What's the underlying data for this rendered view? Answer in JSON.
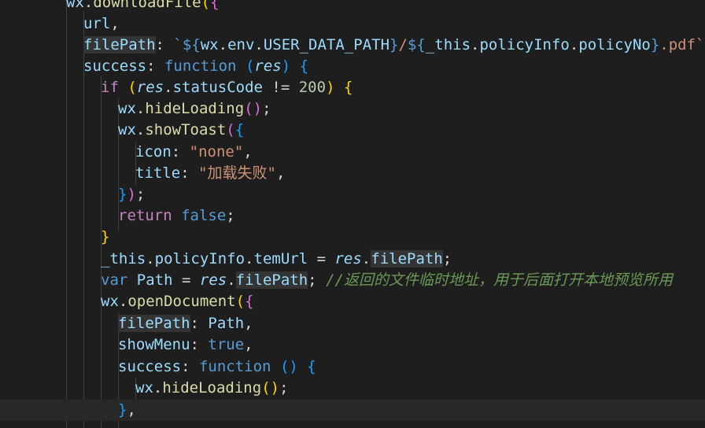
{
  "editor": {
    "lines": [
      [
        [
          "wx",
          "var"
        ],
        [
          ".",
          "p"
        ],
        [
          "downloadFile",
          "fn"
        ],
        [
          "(",
          "b1"
        ],
        [
          "{",
          "b2"
        ]
      ],
      [
        [
          "url",
          "var"
        ],
        [
          ",",
          "p"
        ]
      ],
      [
        [
          "filePath",
          "prop",
          "hl"
        ],
        [
          ": ",
          "p"
        ],
        [
          "`${",
          "kw"
        ],
        [
          "wx",
          "var"
        ],
        [
          ".",
          "p"
        ],
        [
          "env",
          "var"
        ],
        [
          ".",
          "p"
        ],
        [
          "USER_DATA_PATH",
          "var"
        ],
        [
          "}",
          "kw"
        ],
        [
          "/",
          "str"
        ],
        [
          "${",
          "kw"
        ],
        [
          "_this",
          "var"
        ],
        [
          ".",
          "p"
        ],
        [
          "policyInfo",
          "var"
        ],
        [
          ".",
          "p"
        ],
        [
          "policyNo",
          "var"
        ],
        [
          "}",
          "kw"
        ],
        [
          ".pdf`",
          "str"
        ],
        [
          ",",
          "p"
        ]
      ],
      [
        [
          "success",
          "prop"
        ],
        [
          ": ",
          "p"
        ],
        [
          "function",
          "kw"
        ],
        [
          " ",
          "p"
        ],
        [
          "(",
          "b3"
        ],
        [
          "res",
          "var",
          "ital"
        ],
        [
          ")",
          "b3"
        ],
        [
          " ",
          "p"
        ],
        [
          "{",
          "b3"
        ]
      ],
      [
        [
          "if",
          "ctrl"
        ],
        [
          " ",
          "p"
        ],
        [
          "(",
          "b1"
        ],
        [
          "res",
          "var",
          "ital"
        ],
        [
          ".",
          "p"
        ],
        [
          "statusCode",
          "var"
        ],
        [
          " != ",
          "p"
        ],
        [
          "200",
          "num"
        ],
        [
          ")",
          "b1"
        ],
        [
          " ",
          "p"
        ],
        [
          "{",
          "b1"
        ]
      ],
      [
        [
          "wx",
          "var"
        ],
        [
          ".",
          "p"
        ],
        [
          "hideLoading",
          "fn"
        ],
        [
          "()",
          "b2"
        ],
        [
          ";",
          "p"
        ]
      ],
      [
        [
          "wx",
          "var"
        ],
        [
          ".",
          "p"
        ],
        [
          "showToast",
          "fn"
        ],
        [
          "(",
          "b2"
        ],
        [
          "{",
          "b3"
        ]
      ],
      [
        [
          "icon",
          "prop"
        ],
        [
          ": ",
          "p"
        ],
        [
          "\"none\"",
          "str"
        ],
        [
          ",",
          "p"
        ]
      ],
      [
        [
          "title",
          "prop"
        ],
        [
          ": ",
          "p"
        ],
        [
          "\"加载失败\"",
          "str"
        ],
        [
          ",",
          "p"
        ]
      ],
      [
        [
          "}",
          "b3"
        ],
        [
          ")",
          "b2"
        ],
        [
          ";",
          "p"
        ]
      ],
      [
        [
          "return",
          "ctrl"
        ],
        [
          " ",
          "p"
        ],
        [
          "false",
          "kw"
        ],
        [
          ";",
          "p"
        ]
      ],
      [
        [
          "}",
          "b1"
        ]
      ],
      [
        [
          "_this",
          "var"
        ],
        [
          ".",
          "p"
        ],
        [
          "policyInfo",
          "var"
        ],
        [
          ".",
          "p"
        ],
        [
          "temUrl",
          "var"
        ],
        [
          " = ",
          "p"
        ],
        [
          "res",
          "var",
          "ital"
        ],
        [
          ".",
          "p"
        ],
        [
          "filePath",
          "var",
          "hl"
        ],
        [
          ";",
          "p"
        ]
      ],
      [
        [
          "var",
          "kw"
        ],
        [
          " ",
          "p"
        ],
        [
          "Path",
          "var"
        ],
        [
          " = ",
          "p"
        ],
        [
          "res",
          "var",
          "ital"
        ],
        [
          ".",
          "p"
        ],
        [
          "filePath",
          "var",
          "hl"
        ],
        [
          ";",
          "p"
        ],
        [
          " ",
          "p"
        ],
        [
          "//返回的文件临时地址，用于后面打开本地预览所用",
          "cmt"
        ]
      ],
      [
        [
          "wx",
          "var"
        ],
        [
          ".",
          "p"
        ],
        [
          "openDocument",
          "fn"
        ],
        [
          "(",
          "b1"
        ],
        [
          "{",
          "b2"
        ]
      ],
      [
        [
          "filePath",
          "prop",
          "hl"
        ],
        [
          ": ",
          "p"
        ],
        [
          "Path",
          "var"
        ],
        [
          ",",
          "p"
        ]
      ],
      [
        [
          "showMenu",
          "prop"
        ],
        [
          ": ",
          "p"
        ],
        [
          "true",
          "kw"
        ],
        [
          ",",
          "p"
        ]
      ],
      [
        [
          "success",
          "prop"
        ],
        [
          ": ",
          "p"
        ],
        [
          "function",
          "kw"
        ],
        [
          " ",
          "p"
        ],
        [
          "()",
          "b3"
        ],
        [
          " ",
          "p"
        ],
        [
          "{",
          "b3"
        ]
      ],
      [
        [
          "wx",
          "var"
        ],
        [
          ".",
          "p"
        ],
        [
          "hideLoading",
          "fn"
        ],
        [
          "()",
          "b1"
        ],
        [
          ";",
          "p"
        ]
      ],
      [
        [
          "}",
          "b3"
        ],
        [
          ",",
          "p"
        ]
      ]
    ]
  }
}
